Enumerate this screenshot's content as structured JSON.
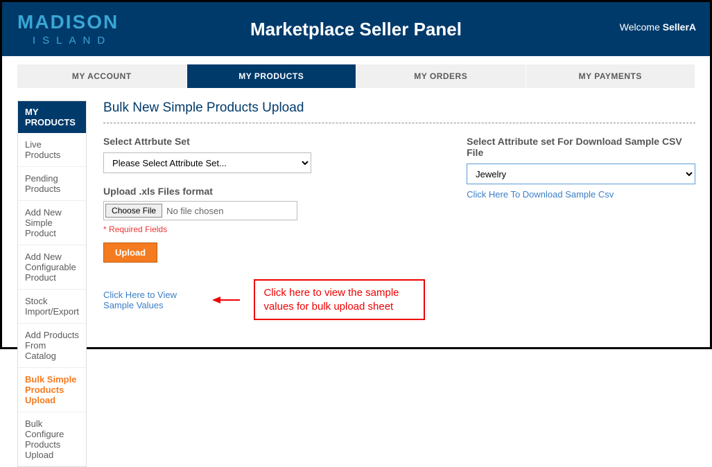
{
  "logo": {
    "top": "MADISON",
    "bottom": "ISLAND"
  },
  "header": {
    "title": "Marketplace Seller Panel",
    "welcome_prefix": "Welcome ",
    "welcome_user": "SellerA"
  },
  "tabs": [
    {
      "label": "MY ACCOUNT",
      "active": false
    },
    {
      "label": "MY PRODUCTS",
      "active": true
    },
    {
      "label": "MY ORDERS",
      "active": false
    },
    {
      "label": "MY PAYMENTS",
      "active": false
    }
  ],
  "sidebar": {
    "title": "MY PRODUCTS",
    "items": [
      {
        "label": "Live Products",
        "active": false
      },
      {
        "label": "Pending Products",
        "active": false
      },
      {
        "label": "Add New Simple Product",
        "active": false
      },
      {
        "label": "Add New Configurable Product",
        "active": false
      },
      {
        "label": "Stock Import/Export",
        "active": false
      },
      {
        "label": "Add Products From Catalog",
        "active": false
      },
      {
        "label": "Bulk Simple Products Upload",
        "active": true
      },
      {
        "label": "Bulk Configure Products Upload",
        "active": false
      }
    ]
  },
  "main": {
    "page_title": "Bulk New Simple Products Upload",
    "attr_set_label": "Select Attrbute Set",
    "attr_set_placeholder": "Please Select Attribute Set...",
    "download_label": "Select Attribute set For Download Sample CSV File",
    "download_selected": "Jewelry",
    "download_link": "Click Here To Download Sample Csv",
    "upload_label": "Upload .xls Files format",
    "choose_file": "Choose File",
    "no_file": "No file chosen",
    "required": "* Required Fields",
    "upload_btn": "Upload",
    "sample_link": "Click Here to View Sample Values",
    "callout": "Click here to view the sample values for bulk upload sheet"
  }
}
